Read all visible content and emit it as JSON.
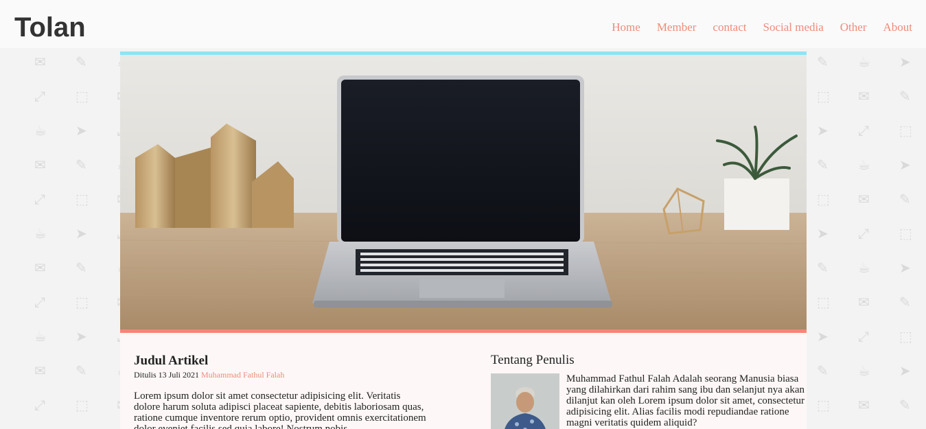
{
  "brand": {
    "logo": "Tolan"
  },
  "nav": {
    "items": [
      "Home",
      "Member",
      "contact",
      "Social media",
      "Other",
      "About"
    ]
  },
  "hero": {
    "image": "laptop-on-wooden-desk-photo"
  },
  "article": {
    "title": "Judul Artikel",
    "meta_prefix": "Ditulis 13 Juli 2021",
    "author": "Muhammad Fathul Falah",
    "body": "Lorem ipsum dolor sit amet consectetur adipisicing elit. Veritatis dolore harum soluta adipisci placeat sapiente, debitis laboriosam quas, ratione cumque inventore rerum optio, provident omnis exercitationem dolor eveniet facilis sed quia labore! Nostrum nobis"
  },
  "sidebar": {
    "title": "Tentang Penulis",
    "photo": "author-avatar",
    "text": "Muhammad Fathul Falah Adalah seorang Manusia biasa yang dilahirkan dari rahim sang ibu dan selanjut nya akan dilanjut kan oleh Lorem ipsum dolor sit amet, consectetur adipisicing elit. Alias facilis modi repudiandae ratione magni veritatis quidem aliquid?"
  },
  "colors": {
    "accent": "#f08a7a",
    "hero_top_border": "#8fe3f5",
    "hero_bottom_border": "#f7857a",
    "background": "#f3f3f3"
  }
}
